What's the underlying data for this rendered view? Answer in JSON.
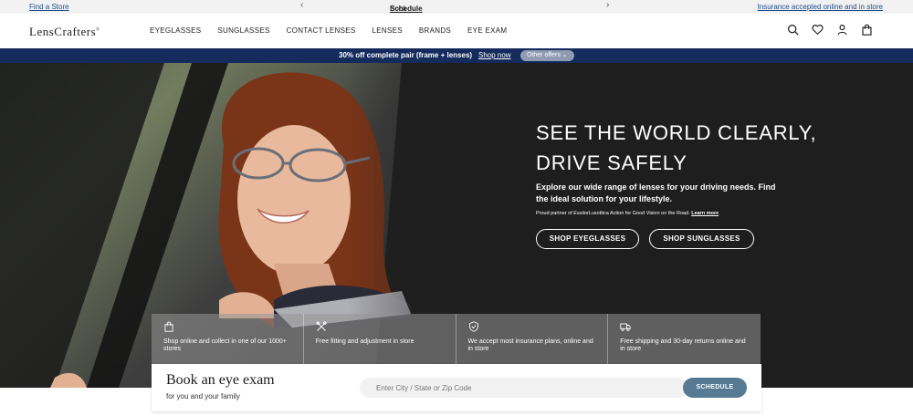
{
  "utility": {
    "find_store": "Find a Store",
    "announcement": "Book an eye exam online.",
    "announcement_link": "Schedule now",
    "insurance": "Insurance accepted online and in store"
  },
  "header": {
    "logo": "LensCrafters",
    "nav": [
      "EYEGLASSES",
      "SUNGLASSES",
      "CONTACT LENSES",
      "LENSES",
      "BRANDS",
      "EYE EXAM"
    ],
    "icons": [
      "search-icon",
      "heart-icon",
      "user-icon",
      "bag-icon"
    ]
  },
  "promo": {
    "text": "30% off complete pair (frame + lenses)",
    "link": "Shop now",
    "offers": "Other offers"
  },
  "hero": {
    "title_line1": "SEE THE WORLD CLEARLY,",
    "title_line2": "DRIVE SAFELY",
    "subtitle": "Explore our wide range of lenses for your driving needs. Find the ideal solution for your lifestyle.",
    "note": "Proud partner of EssilorLuxottica Action for Good Vision on the Road.",
    "note_link": "Learn more",
    "btn_eyeglasses": "SHOP EYEGLASSES",
    "btn_sunglasses": "SHOP SUNGLASSES"
  },
  "features": [
    {
      "icon": "shopping-bag-icon",
      "text": "Shop online and collect in one of our 1000+ stores"
    },
    {
      "icon": "tools-icon",
      "text": "Free fitting and adjustment in store"
    },
    {
      "icon": "shield-check-icon",
      "text": "We accept most insurance plans, online and in store"
    },
    {
      "icon": "truck-icon",
      "text": "Free shipping and 30-day returns online and in store"
    }
  ],
  "booking": {
    "title": "Book an eye exam",
    "subtitle": "for you and your family",
    "placeholder": "Enter City / State or Zip Code",
    "button": "SCHEDULE"
  },
  "colors": {
    "promo_bg": "#142b5c",
    "link_blue": "#1d4a8c",
    "schedule_btn": "#567a94"
  }
}
